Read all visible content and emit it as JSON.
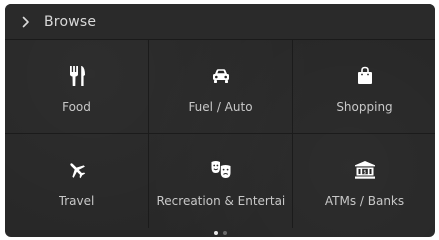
{
  "header": {
    "title": "Browse"
  },
  "tiles": [
    {
      "label": "Food",
      "icon": "fork-knife-icon"
    },
    {
      "label": "Fuel / Auto",
      "icon": "car-icon"
    },
    {
      "label": "Shopping",
      "icon": "shopping-bag-icon"
    },
    {
      "label": "Travel",
      "icon": "airplane-icon"
    },
    {
      "label": "Recreation & Entertai",
      "icon": "theater-masks-icon"
    },
    {
      "label": "ATMs / Banks",
      "icon": "bank-icon"
    }
  ],
  "pagination": {
    "pages": 2,
    "current": 1
  },
  "colors": {
    "background": "#262626",
    "text": "#d8d8d8",
    "icon": "#ffffff"
  }
}
